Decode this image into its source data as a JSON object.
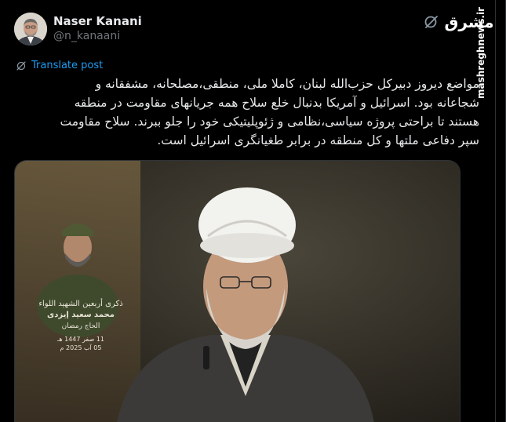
{
  "author": {
    "display_name": "Naser Kanani",
    "handle": "@n_kanaani"
  },
  "watermark": {
    "logo_text": "مشرق",
    "site": "mashreghnews.ir"
  },
  "translate_label": "Translate post",
  "post_text_lines": [
    "مواضع دیروز دبیرکل حزب‌الله لبنان، کاملا ملی، منطقی،مصلحانه، مشفقانه و",
    "شجاعانه بود. اسرائیل و آمریکا بدنبال خلع سلاح همه جریانهای مقاومت در منطقه",
    "هستند تا براحتی پروژه سیاسی،نظامی و ژئوپلیتیکی خود را جلو ببرند. سلاح مقاومت",
    "سپر دفاعی ملتها و کل منطقه در برابر طغیانگری اسرائیل است."
  ],
  "media": {
    "poster_lines": [
      "ذکری أربعین الشهید اللواء",
      "محمد سعید إیزدی",
      "الحاج رمضان"
    ],
    "poster_dates": [
      "11 صفر 1447 هـ",
      "05 آب 2025 م"
    ]
  },
  "colors": {
    "background": "#000000",
    "text": "#e7e9ea",
    "secondary": "#71767b",
    "link": "#1d9bf0",
    "border": "#2f3336"
  },
  "icons": [
    "avatar",
    "grok-icon",
    "translate-icon"
  ]
}
